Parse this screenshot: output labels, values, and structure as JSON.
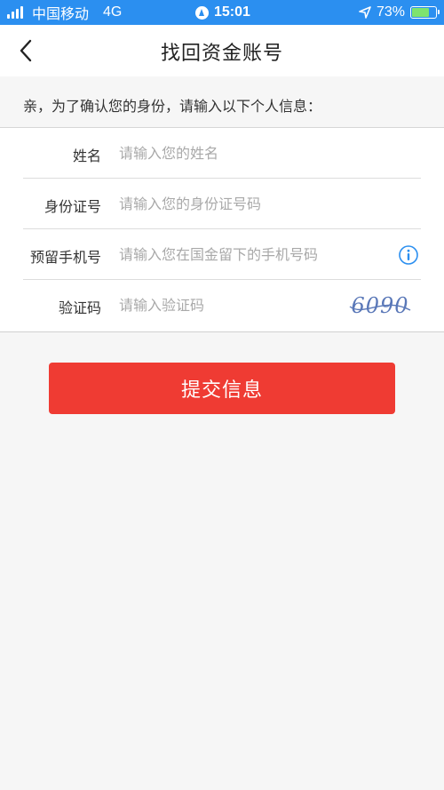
{
  "status_bar": {
    "carrier": "中国移动",
    "network": "4G",
    "time": "15:01",
    "battery_percent": "73%",
    "battery_level": 0.73
  },
  "nav": {
    "title": "找回资金账号"
  },
  "prompt": "亲，为了确认您的身份，请输入以下个人信息：",
  "form": {
    "name": {
      "label": "姓名",
      "placeholder": "请输入您的姓名",
      "value": ""
    },
    "id_number": {
      "label": "身份证号",
      "placeholder": "请输入您的身份证号码",
      "value": ""
    },
    "phone": {
      "label": "预留手机号",
      "placeholder": "请输入您在国金留下的手机号码",
      "value": ""
    },
    "captcha": {
      "label": "验证码",
      "placeholder": "请输入验证码",
      "value": "",
      "image_text": "6090"
    }
  },
  "submit_label": "提交信息",
  "colors": {
    "status_bar": "#2b8ff0",
    "submit": "#ef3b33",
    "info_icon": "#2b8ff0"
  }
}
